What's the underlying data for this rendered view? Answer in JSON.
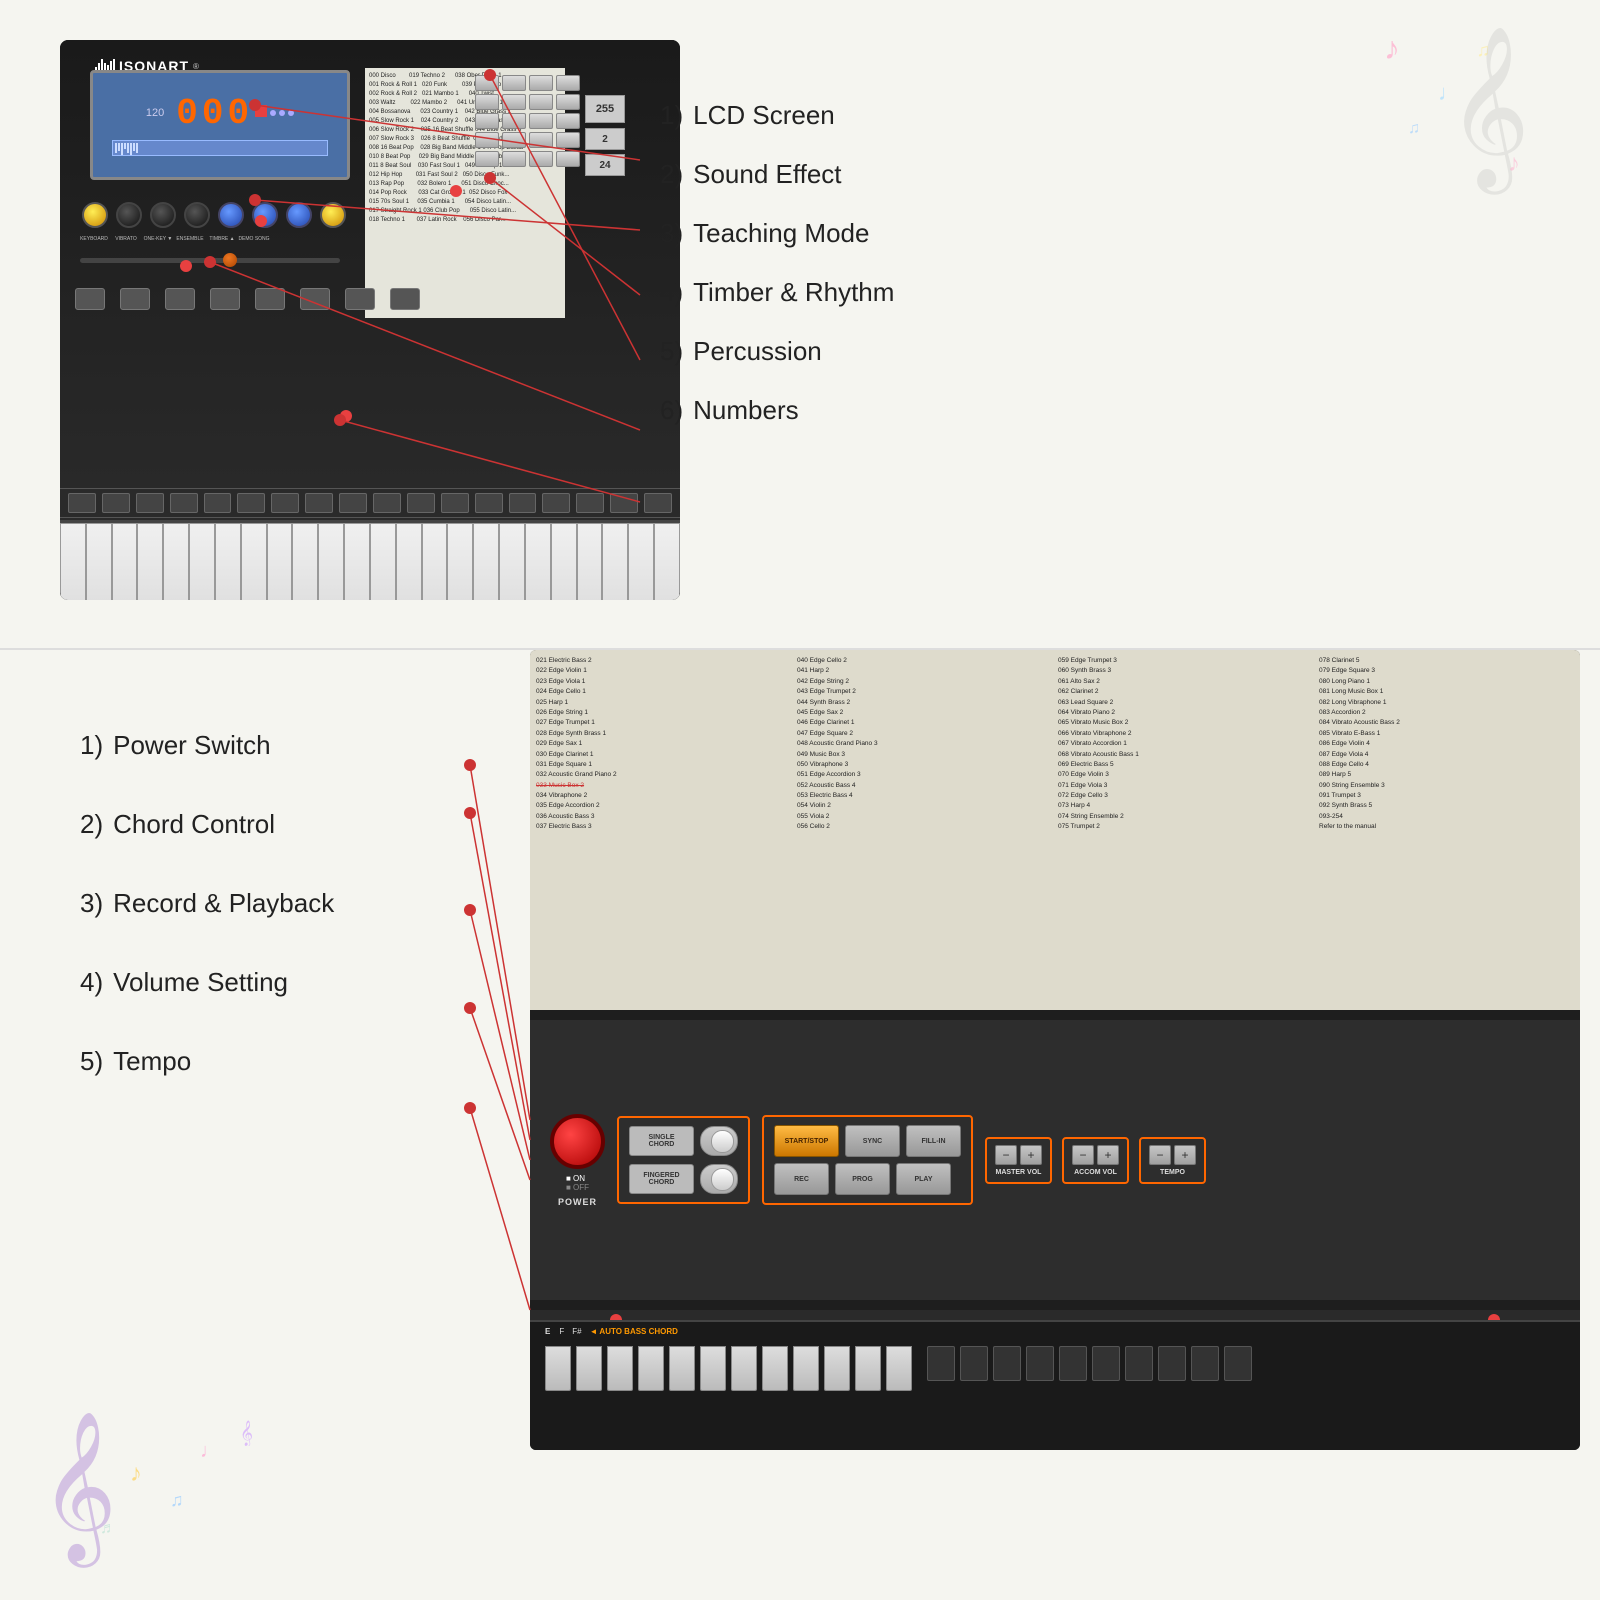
{
  "top": {
    "title": "ISONART",
    "lcd": {
      "bpm": "120",
      "number": "000"
    },
    "labels": [
      {
        "num": "1)",
        "text": "LCD Screen"
      },
      {
        "num": "2)",
        "text": "Sound Effect"
      },
      {
        "num": "3)",
        "text": "Teaching Mode"
      },
      {
        "num": "4)",
        "text": "Timber & Rhythm"
      },
      {
        "num": "5)",
        "text": "Percussion"
      },
      {
        "num": "6)",
        "text": "Numbers"
      }
    ],
    "song_list": [
      "000 Disco",
      "019 Techno 2",
      "038 Ober Polka 1",
      "001 Rock & Roll 1",
      "020 Funk",
      "039 Polka Pop",
      "002 Rock & Roll 2",
      "021 Mambo 1",
      "040 Twist",
      "003 Waltz",
      "022 Mambo 2",
      "041 Unplugged 1",
      "004 Bossanova",
      "023 Country 1",
      "042 Blue Grass 1",
      "005 Slow Rock 1",
      "024 Country 2",
      "043 Blue Grass 2",
      "006 Slow Rock 2",
      "025 16 Beat Shuffle",
      "044 Blue Grass 3",
      "007 Slow Rock 3",
      "026 8 Beat Shuffle",
      "045 Saturday Nig...",
      "008 16 Beat Pop",
      "028 Big Band Middle 1",
      "047 Pop Ballad",
      "010 8 Beat Pop",
      "029 Big Band Middle 2",
      "048 Urban Pop",
      "011 8 Beat Soul",
      "030 Fast Soul 1",
      "049 UK Pop 1",
      "012 Hip Hop",
      "031 Fast Soul 2",
      "050 Disco Funk...",
      "013 Rap Pop",
      "032 Bolero 1",
      "051 Disco Choc...",
      "014 Pop Rock",
      "033 Cat Groove 1",
      "052 Disco Fox",
      "015 70s Soul 1",
      "035 Cumbia 1",
      "054 Disco Latin...",
      "017 Straight Rock 1",
      "036 Club Pop",
      "055 Disco Latin...",
      "018 Techno 1",
      "037 Latin Rock",
      "056 Disco Par..."
    ]
  },
  "bottom": {
    "labels": [
      {
        "num": "1)",
        "text": "Power Switch"
      },
      {
        "num": "2)",
        "text": "Chord Control"
      },
      {
        "num": "3)",
        "text": "Record & Playback"
      },
      {
        "num": "4)",
        "text": "Volume Setting"
      },
      {
        "num": "5)",
        "text": "Tempo"
      }
    ],
    "power": {
      "on": "■ ON",
      "off": "■ OFF",
      "label": "POWER"
    },
    "chord_buttons": [
      {
        "label": "SINGLE\nCHORD"
      },
      {
        "label": "FINGERED\nCHORD"
      }
    ],
    "playback_buttons": [
      {
        "label": "START/STOP",
        "style": "orange"
      },
      {
        "label": "SYNC",
        "style": "normal"
      },
      {
        "label": "FILL-IN",
        "style": "normal"
      },
      {
        "label": "REC",
        "style": "normal"
      },
      {
        "label": "PROG",
        "style": "normal"
      },
      {
        "label": "PLAY",
        "style": "normal"
      }
    ],
    "volume_sections": [
      {
        "label": "MASTER VOL"
      },
      {
        "label": "ACCOM VOL"
      },
      {
        "label": "TEMPO"
      }
    ],
    "bass_chord": {
      "label": "F#◄ AUTO BASS CHORD",
      "keys": [
        "E",
        "F",
        "F#"
      ]
    },
    "sound_list": [
      "021 Electric Bass 2",
      "040 Edge Cello 2",
      "059 Edge Trumpet 3",
      "078 Clarinet 5",
      "022 Edge Violin 1",
      "041 Harp 2",
      "060 Synth Brass 3",
      "079 Edge Square 3",
      "023 Edge Viola 1",
      "042 Edge String 2",
      "061 Alto Sax 2",
      "080 Long Piano 1",
      "024 Edge Cello 1",
      "043 Edge Trumpet 2",
      "062 Clarinet 2",
      "081 Long Music Box 1",
      "025 Harp 1",
      "044 Synth Brass 2",
      "063 Lead Square 2",
      "082 Long Vibraphone 1",
      "026 Edge String 1",
      "045 Edge Sax 2",
      "064 Vibrato Piano 2",
      "083 Accordion 2",
      "027 Edge Trumpet 1",
      "046 Edge Clarinet 1",
      "065 Vibrato Music Box 2",
      "084 Vibrato Acoustic Bass 2",
      "028 Edge Synth Brass 1",
      "047 Edge Square 2",
      "066 Vibrato Vibraphone 2",
      "085 Vibrato E-Bass 1",
      "029 Edge Sax 1",
      "048 Acoustic Grand Piano 3",
      "067 Vibrato Accordion 1",
      "086 Edge Violin 4",
      "030 Edge Clarinet 1",
      "049 Music Box 3",
      "068 Vibrato Acoustic Bass 1",
      "087 Edge Viola 4",
      "031 Edge Square 1",
      "050 Vibraphone 3",
      "069 Electric Bass 5",
      "088 Edge Cello 4",
      "032 Acoustic Grand Piano 2",
      "051 Edge Accordion 3",
      "070 Edge Violin 3",
      "089 Harp 5",
      "033 Music Box 2",
      "052 Acoustic Bass 4",
      "071 Edge Viola 3",
      "090 String Ensemble 3",
      "034 Vibraphone 2",
      "053 Electric Bass 4",
      "072 Edge Cello 3",
      "091 Trumpet 3",
      "035 Edge Accordion 2",
      "054 Violin 2",
      "073 Harp 4",
      "092 Synth Brass 5",
      "036 Acoustic Bass 3",
      "055 Viola 2",
      "074 String Ensemble 2",
      "093-254",
      "037 Electric Bass 3",
      "056 Cello 2",
      "075 Trumpet 2",
      "Refer to the manual"
    ]
  }
}
